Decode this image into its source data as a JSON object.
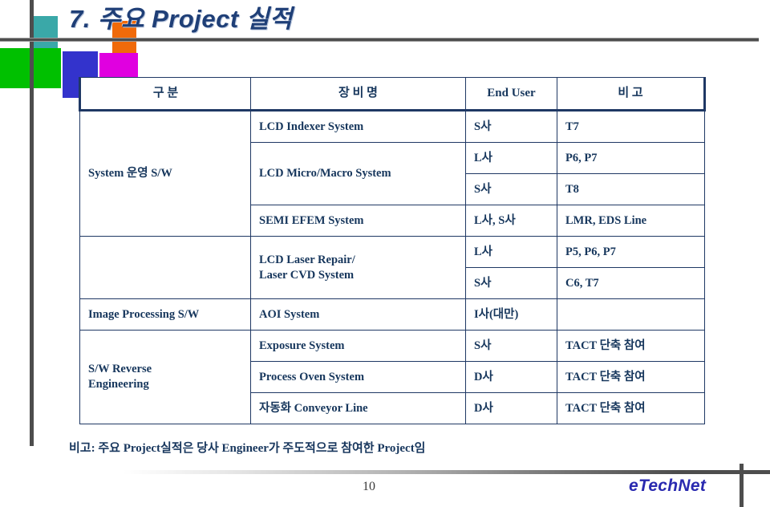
{
  "slide": {
    "title": "7. 주요 Project 실적",
    "page_number": "10",
    "brand": "eTechNet",
    "footer_note": "비고: 주요 Project실적은 당사 Engineer가 주도적으로 참여한 Project임"
  },
  "logo": {
    "colors": {
      "teal": "#3aa8a8",
      "orange": "#f06a0a",
      "green": "#00c000",
      "blue": "#3333cc",
      "magenta": "#e000e0",
      "rule": "#4d4d4d"
    }
  },
  "theme": {
    "title_color": "#1f3f77",
    "table_text": "#16365c",
    "table_border": "#1f3864",
    "brand_color": "#2a2ab0"
  },
  "table": {
    "headers": [
      "구  분",
      "장  비  명",
      "End User",
      "비   고"
    ],
    "rows": [
      {
        "category": "",
        "equipment": "LCD Indexer System",
        "end_user": "S사",
        "remark": "T7"
      },
      {
        "category": "",
        "equipment": "LCD Micro/Macro System",
        "end_user": "L사",
        "remark": "P6, P7"
      },
      {
        "category": "System 운영 S/W",
        "equipment": "",
        "end_user": "S사",
        "remark": "T8"
      },
      {
        "category": "",
        "equipment": "SEMI EFEM System",
        "end_user": "L사, S사",
        "remark": "LMR, EDS Line"
      },
      {
        "category": "",
        "equipment": "LCD Laser Repair/\nLaser CVD System",
        "equipment_line1": "LCD Laser Repair/",
        "equipment_line2": "Laser CVD System",
        "end_user": "L사",
        "remark": "P5, P6, P7"
      },
      {
        "category": "",
        "equipment": "",
        "end_user": "S사",
        "remark": "C6, T7"
      },
      {
        "category": "Image Processing  S/W",
        "equipment": "AOI System",
        "end_user": "I사(대만)",
        "remark": ""
      },
      {
        "category": "",
        "equipment": "Exposure System",
        "end_user": "S사",
        "remark": "TACT 단축 참여"
      },
      {
        "category": "S/W Reverse\nEngineering",
        "category_line1": "S/W Reverse",
        "category_line2": "Engineering",
        "equipment": "Process Oven System",
        "end_user": "D사",
        "remark": "TACT 단축 참여"
      },
      {
        "category": "",
        "equipment": "자동화 Conveyor  Line",
        "end_user": "D사",
        "remark": "TACT 단축 참여"
      }
    ]
  }
}
